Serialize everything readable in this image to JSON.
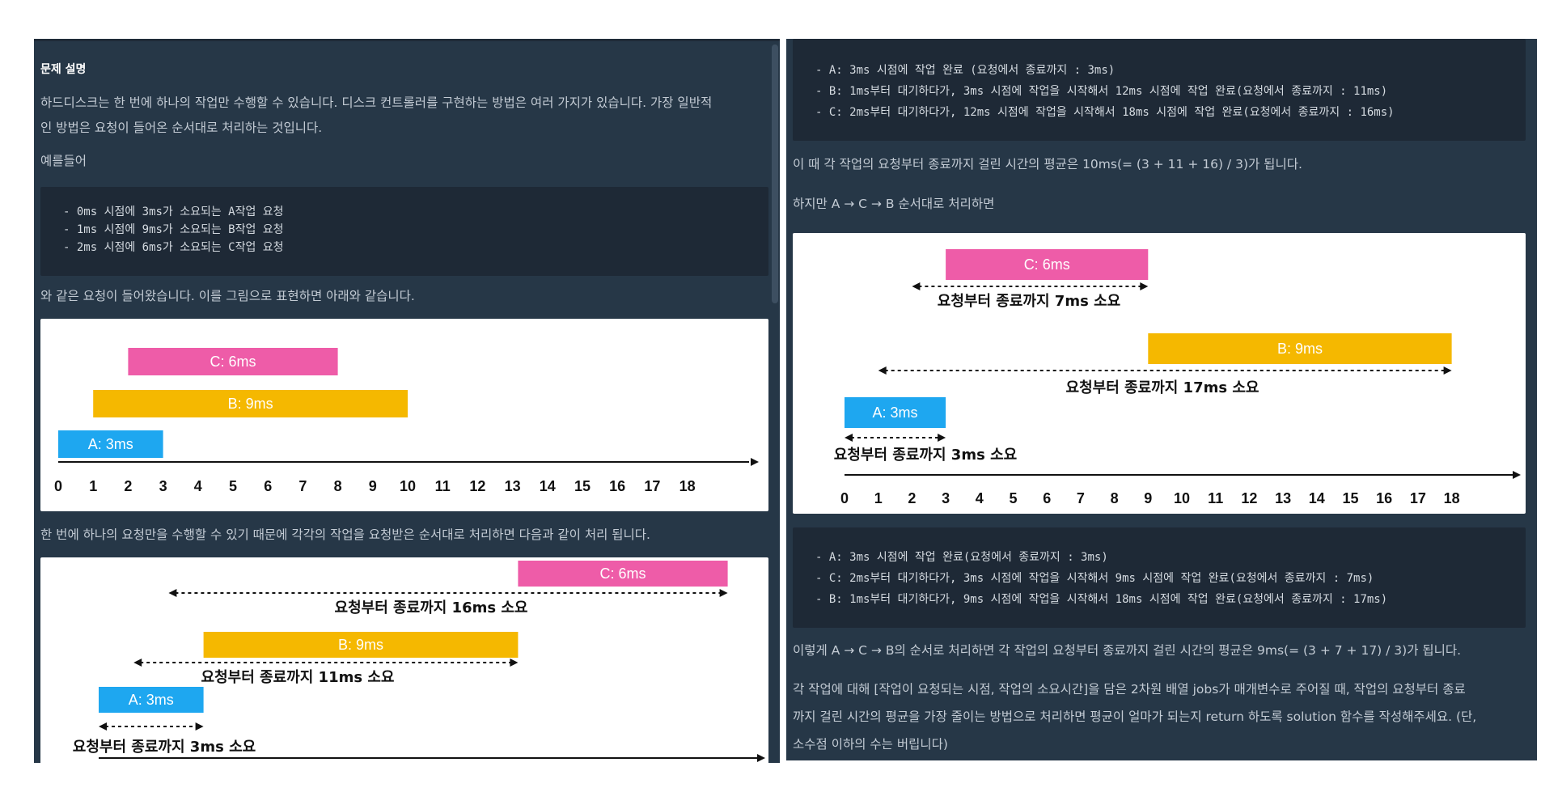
{
  "left": {
    "heading": "문제 설명",
    "p1a": "하드디스크는 한 번에 하나의 작업만 수행할 수 있습니다. 디스크 컨트롤러를 구현하는 방법은 여러 가지가 있습니다. 가장 일반적",
    "p1b": "인 방법은 요청이 들어온 순서대로 처리하는 것입니다.",
    "p2": "예를들어",
    "code": [
      "- 0ms 시점에 3ms가 소요되는 A작업 요청",
      "- 1ms 시점에 9ms가 소요되는 B작업 요청",
      "- 2ms 시점에 6ms가 소요되는 C작업 요청"
    ],
    "p3": "와 같은 요청이 들어왔습니다. 이를 그림으로 표현하면 아래와 같습니다.",
    "p4": "한 번에 하나의 요청만을 수행할 수 있기 때문에 각각의 작업을 요청받은 순서대로 처리하면 다음과 같이 처리 됩니다."
  },
  "right": {
    "code1": [
      "- A: 3ms 시점에 작업 완료 (요청에서 종료까지 : 3ms)",
      "- B: 1ms부터 대기하다가, 3ms 시점에 작업을 시작해서 12ms 시점에 작업 완료(요청에서 종료까지 : 11ms)",
      "- C: 2ms부터 대기하다가, 12ms 시점에 작업을 시작해서 18ms 시점에 작업 완료(요청에서 종료까지 : 16ms)"
    ],
    "p1": "이 때 각 작업의 요청부터 종료까지 걸린 시간의 평균은 10ms(= (3 + 11 + 16) / 3)가 됩니다.",
    "p2": "하지만 A → C → B 순서대로 처리하면",
    "code2": [
      "- A: 3ms 시점에 작업 완료(요청에서 종료까지 : 3ms)",
      "- C: 2ms부터 대기하다가, 3ms 시점에 작업을 시작해서 9ms 시점에 작업 완료(요청에서 종료까지 : 7ms)",
      "- B: 1ms부터 대기하다가, 9ms 시점에 작업을 시작해서 18ms 시점에 작업 완료(요청에서 종료까지 : 17ms)"
    ],
    "p3": "이렇게 A → C → B의 순서로 처리하면 각 작업의 요청부터 종료까지 걸린 시간의 평균은 9ms(= (3 + 7 + 17) / 3)가 됩니다.",
    "p4a": "각 작업에 대해 [작업이 요청되는 시점, 작업의 소요시간]을 담은 2차원 배열 jobs가 매개변수로 주어질 때, 작업의 요청부터 종료",
    "p4b": "까지 걸린 시간의 평균을 가장 줄이는 방법으로 처리하면 평균이 얼마가 되는지 return 하도록 solution 함수를 작성해주세요. (단,",
    "p4c": "소수점 이하의 수는 버립니다)"
  },
  "figures": {
    "fig1": {
      "bars": [
        {
          "label": "C: 6ms",
          "start": 2,
          "end": 8,
          "color": "#ee5ca8"
        },
        {
          "label": "B: 9ms",
          "start": 1,
          "end": 10,
          "color": "#f5b800"
        },
        {
          "label": "A: 3ms",
          "start": 0,
          "end": 3,
          "color": "#1ea7f0"
        }
      ],
      "ticks": [
        "0",
        "1",
        "2",
        "3",
        "4",
        "5",
        "6",
        "7",
        "8",
        "9",
        "10",
        "11",
        "12",
        "13",
        "14",
        "15",
        "16",
        "17",
        "18"
      ]
    },
    "fig2": {
      "bars": [
        {
          "label": "C: 6ms",
          "start": 12,
          "end": 18,
          "color": "#ee5ca8"
        },
        {
          "label": "B: 9ms",
          "start": 3,
          "end": 12,
          "color": "#f5b800"
        },
        {
          "label": "A: 3ms",
          "start": 0,
          "end": 3,
          "color": "#1ea7f0"
        }
      ],
      "spans": [
        {
          "start": 2,
          "end": 18,
          "label": "요청부터 종료까지 16ms 소요"
        },
        {
          "start": 1,
          "end": 12,
          "label": "요청부터 종료까지 11ms 소요"
        },
        {
          "start": 0,
          "end": 3,
          "label": "요청부터 종료까지 3ms 소요"
        }
      ]
    },
    "fig3": {
      "bars": [
        {
          "label": "C: 6ms",
          "start": 3,
          "end": 9,
          "color": "#ee5ca8"
        },
        {
          "label": "B: 9ms",
          "start": 9,
          "end": 18,
          "color": "#f5b800"
        },
        {
          "label": "A: 3ms",
          "start": 0,
          "end": 3,
          "color": "#1ea7f0"
        }
      ],
      "spans": [
        {
          "start": 2,
          "end": 9,
          "label": "요청부터 종료까지 7ms 소요"
        },
        {
          "start": 1,
          "end": 18,
          "label": "요청부터 종료까지 17ms 소요"
        },
        {
          "start": 0,
          "end": 3,
          "label": "요청부터 종료까지 3ms 소요"
        }
      ],
      "ticks": [
        "0",
        "1",
        "2",
        "3",
        "4",
        "5",
        "6",
        "7",
        "8",
        "9",
        "10",
        "11",
        "12",
        "13",
        "14",
        "15",
        "16",
        "17",
        "18"
      ]
    }
  }
}
